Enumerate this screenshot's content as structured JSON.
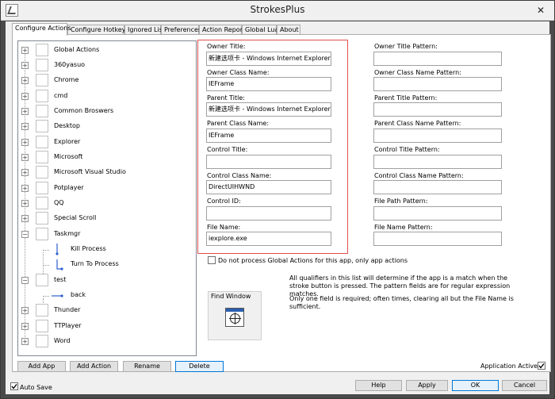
{
  "window": {
    "title": "StrokesPlus"
  },
  "tabs": [
    {
      "label": "Configure Actions"
    },
    {
      "label": "Configure Hotkeys"
    },
    {
      "label": "Ignored List"
    },
    {
      "label": "Preferences"
    },
    {
      "label": "Action Report"
    },
    {
      "label": "Global Lua"
    },
    {
      "label": "About"
    }
  ],
  "tree": {
    "items": [
      {
        "label": "Global Actions",
        "expander": "+"
      },
      {
        "label": "360yasuo",
        "expander": "+"
      },
      {
        "label": "Chrome",
        "expander": "+"
      },
      {
        "label": "cmd",
        "expander": "+"
      },
      {
        "label": "Common Broswers",
        "expander": "+"
      },
      {
        "label": "Desktop",
        "expander": "+"
      },
      {
        "label": "Explorer",
        "expander": "+"
      },
      {
        "label": "Microsoft",
        "expander": "+"
      },
      {
        "label": "Microsoft Visual Studio",
        "expander": "+"
      },
      {
        "label": "Potplayer",
        "expander": "+"
      },
      {
        "label": "QQ",
        "expander": "+"
      },
      {
        "label": "Special Scroll",
        "expander": "+"
      },
      {
        "label": "Taskmgr",
        "expander": "−"
      },
      {
        "label": "Kill Process",
        "child": true
      },
      {
        "label": "Turn To Process",
        "child": true
      },
      {
        "label": "test",
        "expander": "−"
      },
      {
        "label": "back",
        "child": true
      },
      {
        "label": "Thunder",
        "expander": "+"
      },
      {
        "label": "TTPlayer",
        "expander": "+"
      },
      {
        "label": "Word",
        "expander": "+"
      }
    ]
  },
  "fields": {
    "owner_title": {
      "label": "Owner Title:",
      "value": "新建选项卡 - Windows Internet Explorer"
    },
    "owner_class": {
      "label": "Owner Class Name:",
      "value": "IEFrame"
    },
    "parent_title": {
      "label": "Parent Title:",
      "value": "新建选项卡 - Windows Internet Explorer"
    },
    "parent_class": {
      "label": "Parent Class Name:",
      "value": "IEFrame"
    },
    "control_title": {
      "label": "Control Title:",
      "value": ""
    },
    "control_class": {
      "label": "Control Class Name:",
      "value": "DirectUIHWND"
    },
    "control_id": {
      "label": "Control ID:",
      "value": ""
    },
    "file_name": {
      "label": "File Name:",
      "value": "iexplore.exe"
    }
  },
  "patterns": {
    "owner_title": {
      "label": "Owner Title Pattern:",
      "value": ""
    },
    "owner_class": {
      "label": "Owner Class Name Pattern:",
      "value": ""
    },
    "parent_title": {
      "label": "Parent Title Pattern:",
      "value": ""
    },
    "parent_class": {
      "label": "Parent Class Name Pattern:",
      "value": ""
    },
    "control_title": {
      "label": "Control Title Pattern:",
      "value": ""
    },
    "control_class": {
      "label": "Control Class Name Pattern:",
      "value": ""
    },
    "file_path": {
      "label": "File Path Pattern:",
      "value": ""
    },
    "file_name": {
      "label": "File Name Pattern:",
      "value": ""
    }
  },
  "options": {
    "no_global": {
      "label": "Do not process Global Actions for this app, only app actions",
      "checked": false
    }
  },
  "find_window": {
    "label": "Find Window"
  },
  "info": {
    "line1": "All qualifiers in this list will determine if the app is a match when the stroke button is pressed. The pattern fields are for regular expression matches.",
    "line2": "Only one field is required; often times, clearing all but the File Name is sufficient."
  },
  "buttons": {
    "add_app": "Add App",
    "add_action": "Add Action",
    "rename": "Rename",
    "delete": "Delete",
    "help": "Help",
    "apply": "Apply",
    "cancel": "Cancel",
    "ok": "OK"
  },
  "app_active": {
    "label": "Application Active",
    "checked": true
  },
  "auto_save": {
    "label": "Auto Save",
    "checked": true
  }
}
